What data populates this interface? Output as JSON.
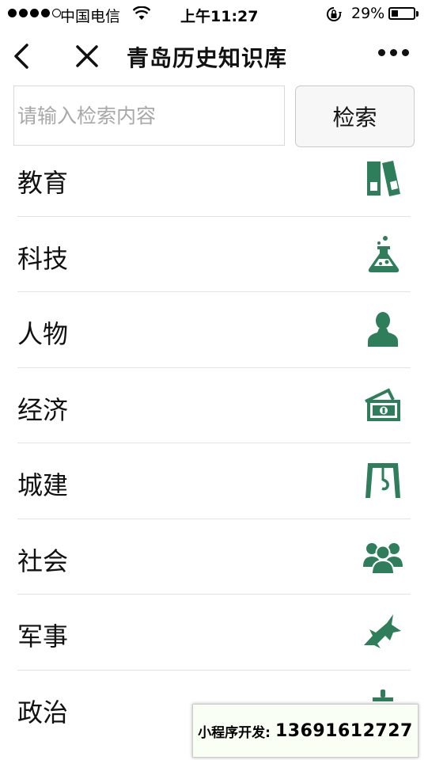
{
  "status_bar": {
    "carrier": "中国电信",
    "time": "上午11:27",
    "battery": "29%",
    "signal_strength": 4,
    "battery_level": 0.29
  },
  "nav": {
    "title": "青岛历史知识库",
    "back_icon": "chevron-left-icon",
    "close_icon": "close-icon",
    "more_icon": "more-dots-icon"
  },
  "search": {
    "placeholder": "请输入检索内容",
    "value": "",
    "button_label": "检索"
  },
  "categories": [
    {
      "label": "教育",
      "icon": "binders-icon"
    },
    {
      "label": "科技",
      "icon": "flask-icon"
    },
    {
      "label": "人物",
      "icon": "person-icon"
    },
    {
      "label": "经济",
      "icon": "money-icon"
    },
    {
      "label": "城建",
      "icon": "crane-icon"
    },
    {
      "label": "社会",
      "icon": "people-group-icon"
    },
    {
      "label": "军事",
      "icon": "fighter-jet-icon"
    },
    {
      "label": "政治",
      "icon": "podium-icon"
    }
  ],
  "promo": {
    "label": "小程序开发:",
    "phone": "13691612727"
  },
  "colors": {
    "icon_green": "#2e7d5b",
    "divider": "#e3e3e3",
    "placeholder": "#a8a8a8"
  }
}
